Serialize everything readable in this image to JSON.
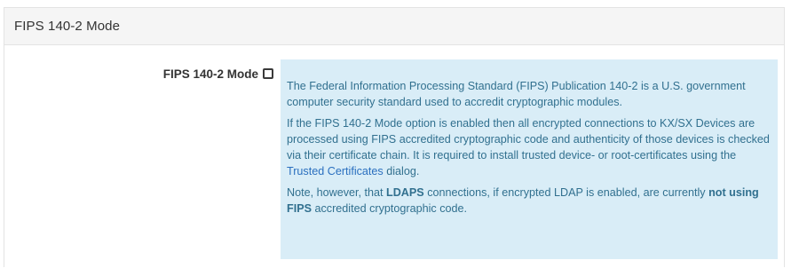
{
  "panel": {
    "title": "FIPS 140-2 Mode"
  },
  "field": {
    "label": "FIPS 140-2 Mode",
    "checked": false
  },
  "help": {
    "para1": "The Federal Information Processing Standard (FIPS) Publication 140-2 is a U.S. government computer security standard used to accredit cryptographic modules.",
    "para2_before_link": "If the FIPS 140-2 Mode option is enabled then all encrypted connections to KX/SX Devices are processed using FIPS accredited cryptographic code and authenticity of those devices is checked via their certificate chain. It is required to install trusted device- or root-certificates using the ",
    "para2_link": "Trusted Certificates",
    "para2_after_link": " dialog.",
    "para3_start": "Note, however, that ",
    "para3_bold1": "LDAPS",
    "para3_middle": " connections, if encrypted LDAP is enabled, are currently ",
    "para3_bold2": "not using FIPS",
    "para3_end": " accredited cryptographic code."
  },
  "colors": {
    "header_bg": "#f5f5f5",
    "help_bg": "#d9edf7",
    "help_text": "#31708f",
    "link": "#2a6fbf"
  }
}
